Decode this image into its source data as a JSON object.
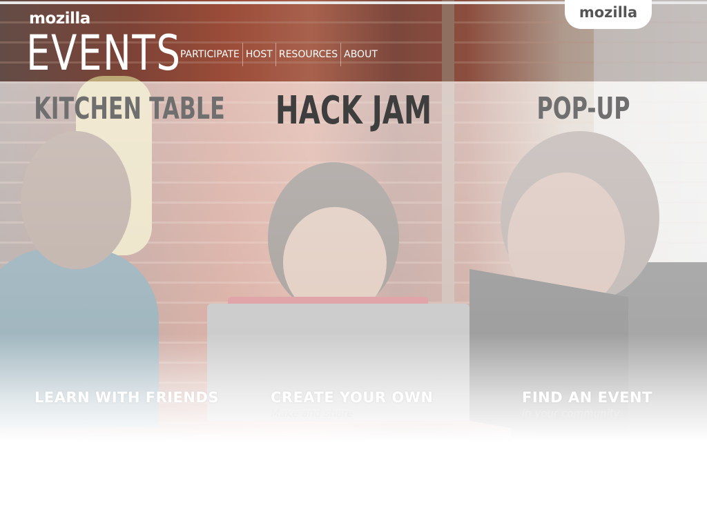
{
  "header": {
    "brand_small": "mozilla",
    "brand_title": "EVENTS",
    "nav": [
      {
        "label": "PARTICIPATE"
      },
      {
        "label": "HOST"
      },
      {
        "label": "RESOURCES"
      },
      {
        "label": "ABOUT"
      }
    ],
    "tab_label": "mozilla"
  },
  "event_types": {
    "kitchen_table": "KITCHEN TABLE",
    "hack_jam": "HACK JAM",
    "pop_up": "POP-UP"
  },
  "callouts": [
    {
      "title": "LEARN WITH FRIENDS",
      "subtitle": ""
    },
    {
      "title": "CREATE YOUR OWN",
      "subtitle": "Make and share"
    },
    {
      "title": "FIND AN EVENT",
      "subtitle": "in your community"
    }
  ],
  "colors": {
    "header_text": "#ffffff",
    "heading_muted": "#6f6f6f",
    "heading_active": "#3e3e3e",
    "tab_background": "#ffffff"
  }
}
